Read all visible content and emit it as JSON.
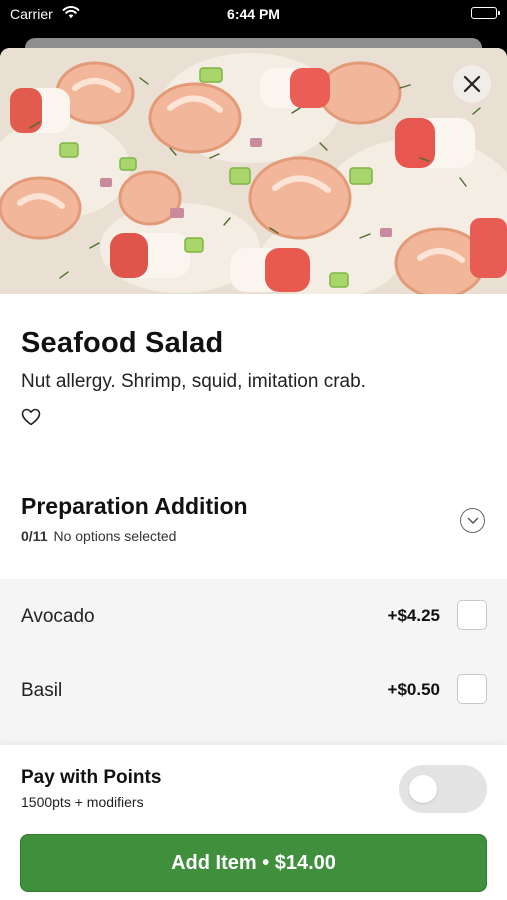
{
  "status_bar": {
    "carrier": "Carrier",
    "time": "6:44 PM",
    "wifi_icon": "wifi-icon",
    "battery_icon": "battery-icon"
  },
  "item": {
    "title": "Seafood Salad",
    "description": "Nut allergy. Shrimp, squid, imitation crab.",
    "image": "seafood-salad-photo",
    "favorite_icon": "heart-outline-icon",
    "close_icon": "close-icon"
  },
  "modifier_group": {
    "title": "Preparation Addition",
    "count": "0/11",
    "status": "No options selected",
    "expand_icon": "chevron-down-icon",
    "options": [
      {
        "name": "Avocado",
        "price": "+$4.25",
        "checked": false
      },
      {
        "name": "Basil",
        "price": "+$0.50",
        "checked": false
      }
    ]
  },
  "footer": {
    "points_title": "Pay with Points",
    "points_subtitle": "1500pts + modifiers",
    "points_toggle_on": false,
    "add_button_label": "Add Item • $14.00"
  },
  "colors": {
    "primary_green": "#3f8f3d",
    "toggle_off": "#e3e3e3",
    "options_background": "#f5f5f5"
  }
}
